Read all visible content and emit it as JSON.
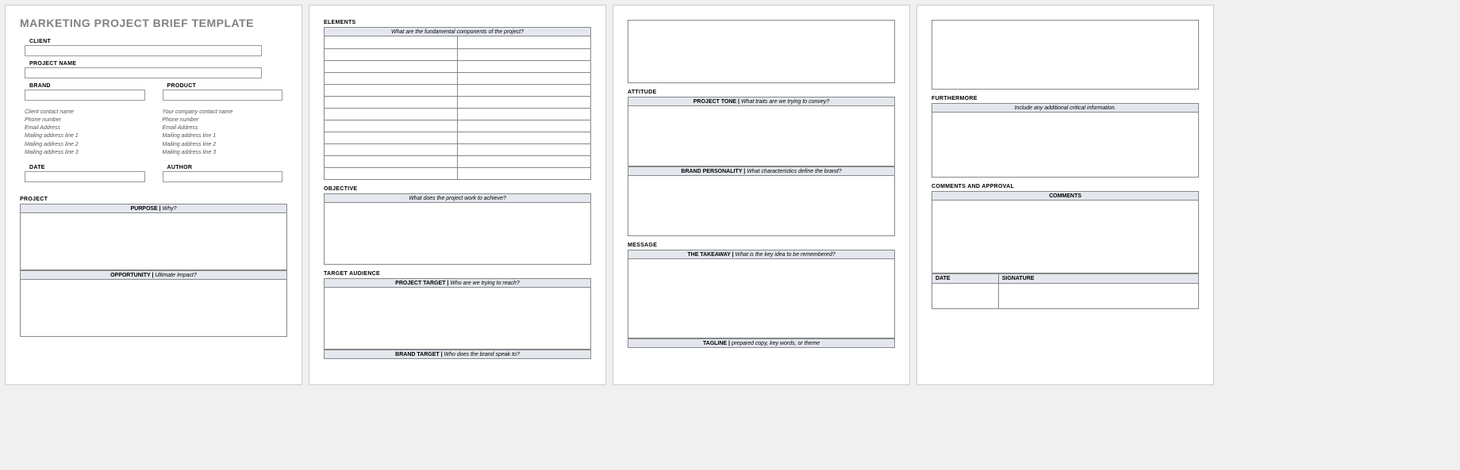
{
  "title": "MARKETING PROJECT BRIEF TEMPLATE",
  "labels": {
    "client": "CLIENT",
    "project_name": "PROJECT NAME",
    "brand": "BRAND",
    "product": "PRODUCT",
    "date": "DATE",
    "author": "AUTHOR"
  },
  "client_meta": {
    "l1": "Client contact name",
    "l2": "Phone number",
    "l3": "Email Address",
    "l4": "Mailing address line 1",
    "l5": "Mailing address line 2",
    "l6": "Mailing address line 3"
  },
  "company_meta": {
    "l1": "Your company contact name",
    "l2": "Phone number",
    "l3": "Email Address",
    "l4": "Mailing address line 1",
    "l5": "Mailing address line 2",
    "l6": "Mailing address line 3"
  },
  "sections": {
    "project": "PROJECT",
    "elements": "ELEMENTS",
    "objective": "OBJECTIVE",
    "target_audience": "TARGET AUDIENCE",
    "attitude": "ATTITUDE",
    "message": "MESSAGE",
    "furthermore": "FURTHERMORE",
    "comments_approval": "COMMENTS AND APPROVAL"
  },
  "bands": {
    "purpose_k": "PURPOSE",
    "purpose_p": "Why?",
    "opportunity_k": "OPPORTUNITY",
    "opportunity_p": "Ultimate Impact?",
    "elements_p": "What are the fundamental components of the project?",
    "objective_p": "What does the project work to achieve?",
    "project_target_k": "PROJECT TARGET",
    "project_target_p": "Who are we trying to reach?",
    "brand_target_k": "BRAND TARGET",
    "brand_target_p": "Who does the brand speak to?",
    "project_tone_k": "PROJECT TONE",
    "project_tone_p": "What traits are we trying to convey?",
    "brand_personality_k": "BRAND PERSONALITY",
    "brand_personality_p": "What characteristics define the brand?",
    "takeaway_k": "THE TAKEAWAY",
    "takeaway_p": "What is the key idea to be remembered?",
    "tagline_k": "TAGLINE",
    "tagline_p": "prepared copy, key words, or theme",
    "furthermore_p": "Include any additional critical information.",
    "comments": "COMMENTS",
    "sig_date": "DATE",
    "sig_signature": "SIGNATURE"
  },
  "sep": "   |   "
}
